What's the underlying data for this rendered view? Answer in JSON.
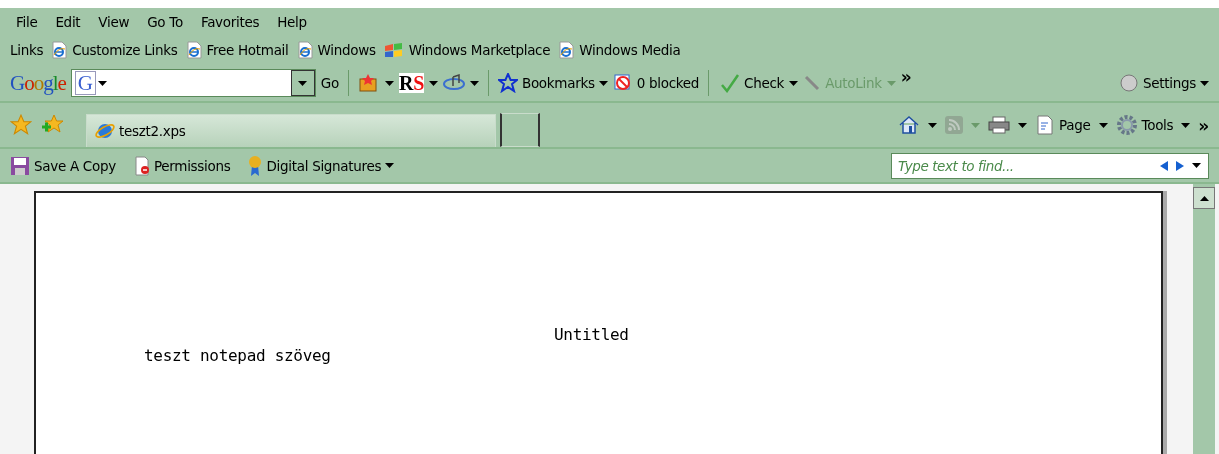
{
  "menu": [
    "File",
    "Edit",
    "View",
    "Go To",
    "Favorites",
    "Help"
  ],
  "links": {
    "label": "Links",
    "items": [
      {
        "label": "Customize Links",
        "kind": "ie"
      },
      {
        "label": "Free Hotmail",
        "kind": "ie"
      },
      {
        "label": "Windows",
        "kind": "ie"
      },
      {
        "label": "Windows Marketplace",
        "kind": "windows"
      },
      {
        "label": "Windows Media",
        "kind": "ie"
      }
    ]
  },
  "google_toolbar": {
    "logo": "Google",
    "search_engine": "G",
    "go": "Go",
    "rs": "RS",
    "bookmarks": "Bookmarks",
    "blocked": "0 blocked",
    "check": "Check",
    "autolink": {
      "label": "AutoLink",
      "disabled": true
    },
    "more": "»",
    "settings": "Settings"
  },
  "tabs": [
    {
      "title": "teszt2.xps",
      "selected": true
    }
  ],
  "command_bar": {
    "items": [
      {
        "kind": "home",
        "disabled": false
      },
      {
        "kind": "feeds",
        "disabled": true
      },
      {
        "kind": "print",
        "disabled": false
      },
      {
        "kind": "page",
        "label": "Page",
        "disabled": false
      },
      {
        "kind": "tools",
        "label": "Tools",
        "disabled": false
      }
    ],
    "more": "»"
  },
  "xps_toolbar": {
    "save": "Save A Copy",
    "permissions": "Permissions",
    "signatures": "Digital Signatures",
    "find": {
      "placeholder": "Type text to find..."
    }
  },
  "document": {
    "title": "Untitled",
    "text": "teszt notepad szöveg"
  }
}
